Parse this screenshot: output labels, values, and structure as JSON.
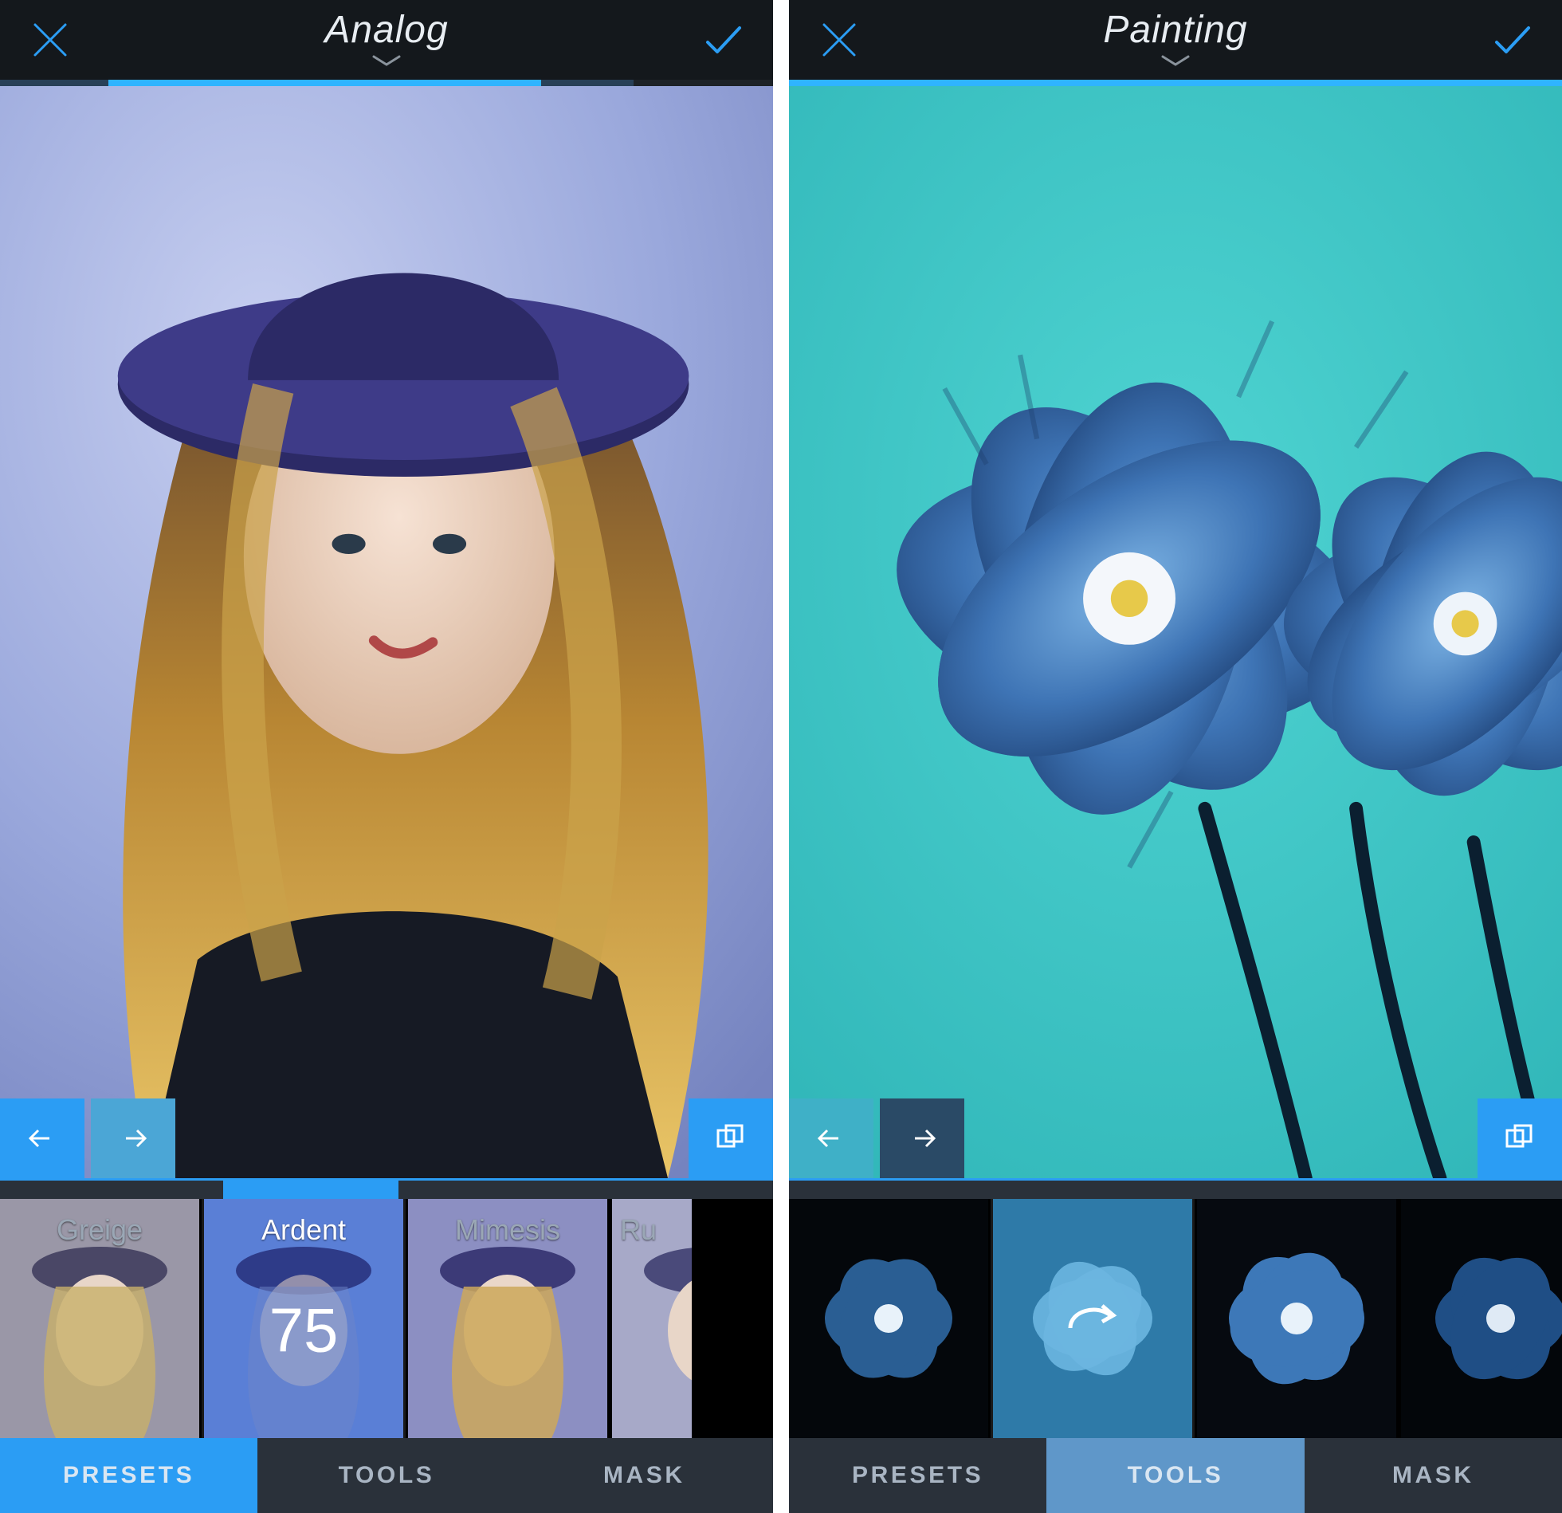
{
  "left": {
    "header": {
      "title": "Analog"
    },
    "progress": {
      "filled_pct": 70
    },
    "canvas": {
      "subject": "portrait-hat"
    },
    "undo_redo": {
      "variant": "blue"
    },
    "presets": [
      {
        "label": "Greige",
        "selected": false
      },
      {
        "label": "Ardent",
        "value": "75",
        "selected": true
      },
      {
        "label": "Mimesis",
        "selected": false
      },
      {
        "label": "Ru",
        "selected": false
      }
    ],
    "tabs": {
      "items": [
        "PRESETS",
        "TOOLS",
        "MASK"
      ],
      "active_index": 0,
      "active_bg": "#2b9df4"
    }
  },
  "right": {
    "header": {
      "title": "Painting"
    },
    "progress": {
      "filled_pct": 100
    },
    "canvas": {
      "subject": "painting-flowers"
    },
    "undo_redo": {
      "variant": "teal"
    },
    "presets": [
      {
        "variant": "flower-dark",
        "selected": false
      },
      {
        "variant": "flower-mid",
        "selected": true,
        "overlay": "redo"
      },
      {
        "variant": "flower-full",
        "selected": false
      },
      {
        "variant": "flower-darker",
        "selected": false
      }
    ],
    "tabs": {
      "items": [
        "PRESETS",
        "TOOLS",
        "MASK"
      ],
      "active_index": 1,
      "active_bg": "#5f97c9"
    }
  },
  "colors": {
    "accent": "#2b9df4",
    "light_blue": "#5f97c9",
    "header_bg": "#14181c",
    "bar_bg": "#2a313a"
  }
}
